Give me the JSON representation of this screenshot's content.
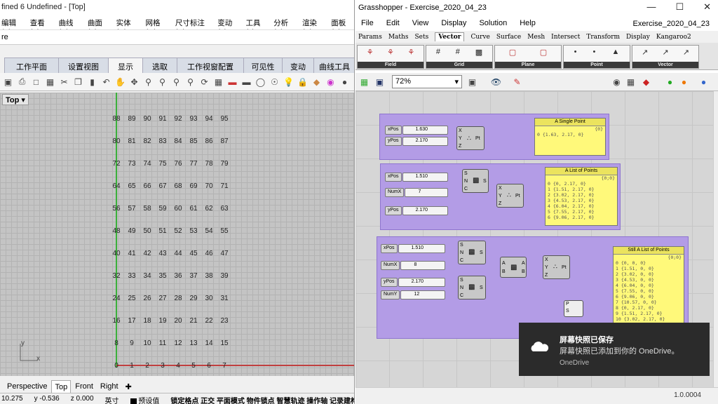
{
  "rhino": {
    "title": "fined 6 Undefined - [Top]",
    "menu": [
      "编辑(E)",
      "查看(V)",
      "曲线(C)",
      "曲面(S)",
      "实体(O)",
      "网格(M)",
      "尺寸标注(D)",
      "变动(T)",
      "工具(L)",
      "分析(A)",
      "渲染(R)",
      "面板(P)"
    ],
    "command_text": "re",
    "tabs": [
      "工作平面",
      "设置视图",
      "显示",
      "选取",
      "工作视窗配置",
      "可见性",
      "变动",
      "曲线工具"
    ],
    "viewport_label": "Top",
    "grid_rows": [
      [
        "88",
        "89",
        "90",
        "91",
        "92",
        "93",
        "94",
        "95"
      ],
      [
        "80",
        "81",
        "82",
        "83",
        "84",
        "85",
        "86",
        "87"
      ],
      [
        "72",
        "73",
        "74",
        "75",
        "76",
        "77",
        "78",
        "79"
      ],
      [
        "64",
        "65",
        "66",
        "67",
        "68",
        "69",
        "70",
        "71"
      ],
      [
        "56",
        "57",
        "58",
        "59",
        "60",
        "61",
        "62",
        "63"
      ],
      [
        "48",
        "49",
        "50",
        "51",
        "52",
        "53",
        "54",
        "55"
      ],
      [
        "40",
        "41",
        "42",
        "43",
        "44",
        "45",
        "46",
        "47"
      ],
      [
        "32",
        "33",
        "34",
        "35",
        "36",
        "37",
        "38",
        "39"
      ],
      [
        "24",
        "25",
        "26",
        "27",
        "28",
        "29",
        "30",
        "31"
      ],
      [
        "16",
        "17",
        "18",
        "19",
        "20",
        "21",
        "22",
        "23"
      ],
      [
        "8",
        "9",
        "10",
        "11",
        "12",
        "13",
        "14",
        "15"
      ],
      [
        "0",
        "1",
        "2",
        "3",
        "4",
        "5",
        "6",
        "7"
      ]
    ],
    "axis_y": "y",
    "axis_x": "x",
    "view_tabs": [
      "Perspective",
      "Top",
      "Front",
      "Right"
    ],
    "status": {
      "x": "10.275",
      "y": "y -0.536",
      "z": "z 0.000",
      "unit": "英寸",
      "layer": "预设值",
      "modes": "锁定格点 正交 平面模式 物件锁点 智慧轨迹 操作轴 记录建构历史 过滤器"
    }
  },
  "gh": {
    "title": "Grasshopper - Exercise_2020_04_23",
    "menu": [
      "File",
      "Edit",
      "View",
      "Display",
      "Solution",
      "Help"
    ],
    "doc_name": "Exercise_2020_04_23",
    "component_tabs": [
      "Params",
      "Maths",
      "Sets",
      "Vector",
      "Curve",
      "Surface",
      "Mesh",
      "Intersect",
      "Transform",
      "Display",
      "Kangaroo2"
    ],
    "ribbon_groups": [
      "Field",
      "Grid",
      "Plane",
      "Point",
      "Vector"
    ],
    "zoom": "72%",
    "group1": {
      "sliders": [
        {
          "label": "xPos",
          "value": "1.630"
        },
        {
          "label": "yPos",
          "value": "2.170"
        }
      ],
      "comp_inputs": [
        "X",
        "Y",
        "Z"
      ],
      "comp_output": "Pt",
      "panel": {
        "title": "A Single Point",
        "tag": "{0}",
        "lines": [
          "0 {1.63, 2.17, 0}"
        ]
      }
    },
    "group2": {
      "sliders": [
        {
          "label": "xPos",
          "value": "1.510"
        },
        {
          "label": "NumX",
          "value": "7"
        },
        {
          "label": "yPos",
          "value": "2.170"
        }
      ],
      "series_inputs": [
        "S",
        "N",
        "C"
      ],
      "comp_inputs": [
        "X",
        "Y",
        "Z"
      ],
      "comp_output": "Pt",
      "panel": {
        "title": "A List of Points",
        "tag": "{0;0}",
        "lines": [
          "0 {0, 2.17, 0}",
          "1 {1.51, 2.17, 0}",
          "2 {3.02, 2.17, 0}",
          "3 {4.53, 2.17, 0}",
          "4 {6.04, 2.17, 0}",
          "5 {7.55, 2.17, 0}",
          "6 {9.06, 2.17, 0}"
        ]
      }
    },
    "group3": {
      "sliders": [
        {
          "label": "xPos",
          "value": "1.510"
        },
        {
          "label": "NumX",
          "value": "8"
        },
        {
          "label": "yPos",
          "value": "2.170"
        },
        {
          "label": "NumY",
          "value": "12"
        }
      ],
      "series_inputs": [
        "S",
        "N",
        "C"
      ],
      "cross_inputs": [
        "A",
        "B"
      ],
      "cross_outputs": [
        "A",
        "B"
      ],
      "comp_inputs": [
        "X",
        "Y",
        "Z"
      ],
      "comp_output": "Pt",
      "bottom_ports": [
        "P",
        "S"
      ],
      "panel": {
        "title": "Still A List of Points",
        "tag": "{0;0}",
        "lines": [
          "0 {0, 0, 0}",
          "1 {1.51, 0, 0}",
          "2 {3.02, 0, 0}",
          "3 {4.53, 0, 0}",
          "4 {6.04, 0, 0}",
          "5 {7.55, 0, 0}",
          "6 {9.06, 0, 0}",
          "7 {10.57, 0, 0}",
          "8 {0, 2.17, 0}",
          "9 {1.51, 2.17, 0}",
          "10 {3.02, 2.17, 0}"
        ]
      }
    },
    "version": "1.0.0004"
  },
  "toast": {
    "title": "屏幕快照已保存",
    "body": "屏幕快照已添加到你的 OneDrive。",
    "app": "OneDrive"
  },
  "colors": {
    "group": "#b39ce6",
    "panel": "#fff97a",
    "x_axis": "#c04040",
    "y_axis": "#3bb03b",
    "toast_bg": "#2b2b2b"
  }
}
